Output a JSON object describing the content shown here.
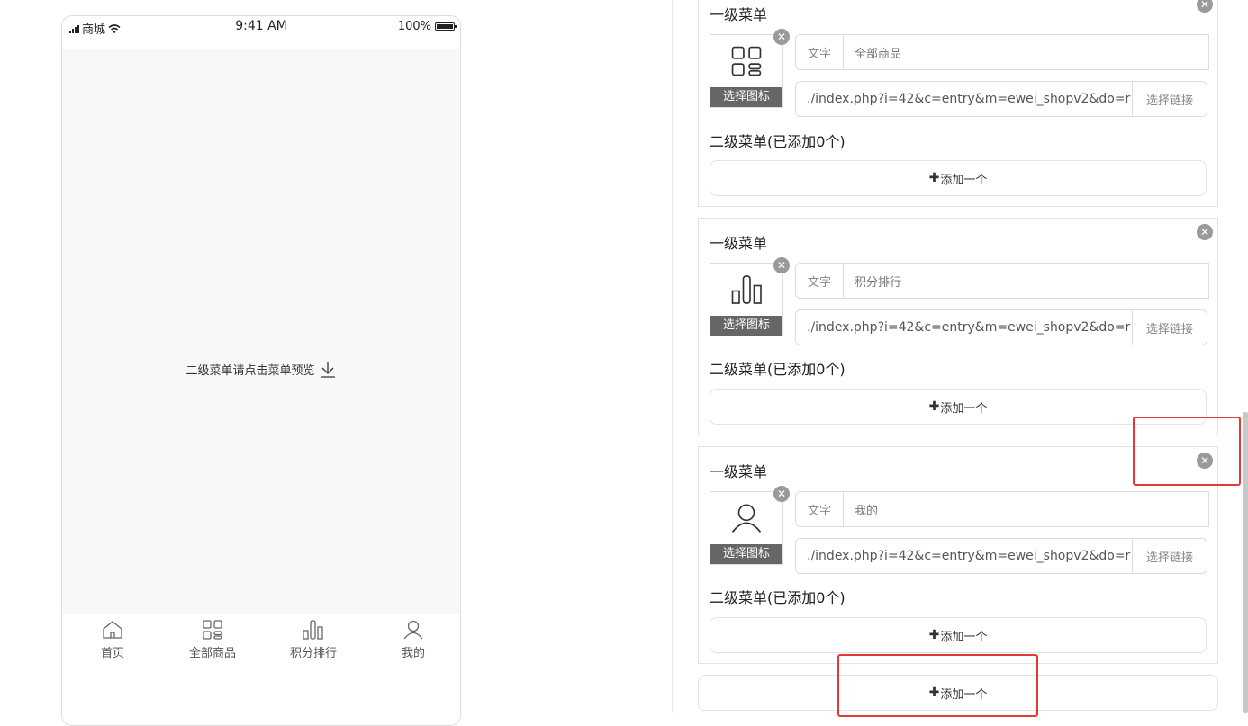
{
  "phone": {
    "status": {
      "carrier": "商城",
      "time": "9:41 AM",
      "battery": "100%"
    },
    "hint": "二级菜单请点击菜单预览",
    "tabs": [
      {
        "label": "首页",
        "icon": "home-icon"
      },
      {
        "label": "全部商品",
        "icon": "grid-icon"
      },
      {
        "label": "积分排行",
        "icon": "bar-chart-icon"
      },
      {
        "label": "我的",
        "icon": "user-icon"
      }
    ]
  },
  "editor": {
    "menus": [
      {
        "title": "一级菜单",
        "icon": "grid-icon",
        "icon_button": "选择图标",
        "text_addon": "文字",
        "text_value": "全部商品",
        "link_value": "./index.php?i=42&c=entry&m=ewei_shopv2&do=r",
        "link_button": "选择链接",
        "submenu_title": "二级菜单(已添加0个)",
        "add_label": "添加一个"
      },
      {
        "title": "一级菜单",
        "icon": "bar-chart-icon",
        "icon_button": "选择图标",
        "text_addon": "文字",
        "text_value": "积分排行",
        "link_value": "./index.php?i=42&c=entry&m=ewei_shopv2&do=r",
        "link_button": "选择链接",
        "submenu_title": "二级菜单(已添加0个)",
        "add_label": "添加一个"
      },
      {
        "title": "一级菜单",
        "icon": "user-icon",
        "icon_button": "选择图标",
        "text_addon": "文字",
        "text_value": "我的",
        "link_value": "./index.php?i=42&c=entry&m=ewei_shopv2&do=r",
        "link_button": "选择链接",
        "submenu_title": "二级菜单(已添加0个)",
        "add_label": "添加一个"
      }
    ],
    "add_menu_label": "添加一个",
    "highlight_color": "#e53935"
  }
}
